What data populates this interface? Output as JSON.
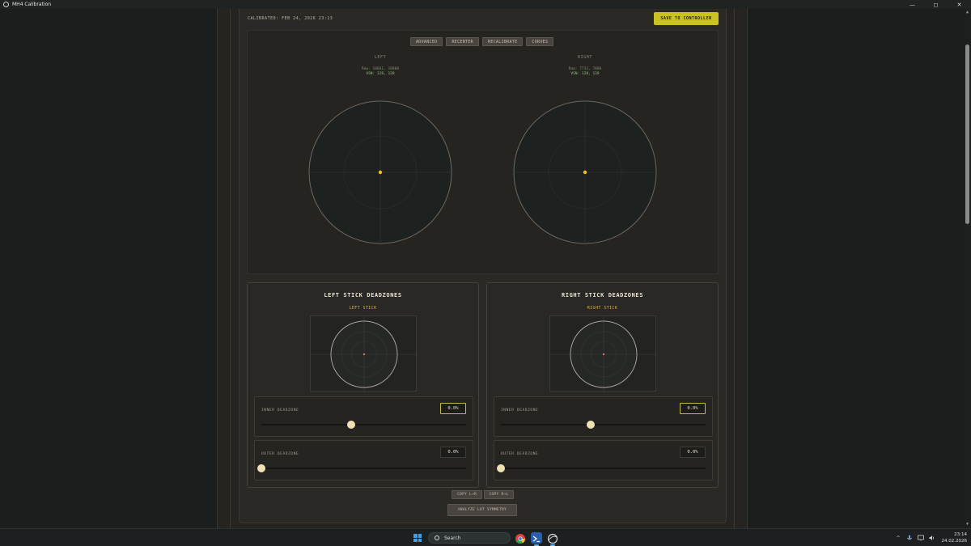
{
  "window": {
    "title": "MH4 Calibration",
    "controls": [
      "—",
      "◻",
      "✕"
    ]
  },
  "header": {
    "calibrated": "CALIBRATED: FEB 24, 2026 23:13",
    "save_label": "SAVE TO CONTROLLER"
  },
  "toolbar": {
    "advanced": "ADVANCED",
    "recenter": "RECENTER",
    "recalibrate": "RECALIBRATE",
    "curves": "CURVES"
  },
  "sticks": {
    "left": {
      "label": "LEFT",
      "raw": "Raw: 18661, 16808",
      "vsn": "VSN: 128, 128"
    },
    "right": {
      "label": "RIGHT",
      "raw": "Raw: 7711, 7806",
      "vsn": "VSN: 128, 128"
    }
  },
  "deadzones": {
    "left": {
      "title": "LEFT STICK DEADZONES",
      "subtitle": "LEFT STICK",
      "inner_label": "INNER DEADZONE",
      "inner_value": "0.0%",
      "inner_level": 0.44,
      "outer_label": "OUTER DEADZONE",
      "outer_value": "0.0%",
      "outer_level": 0.0
    },
    "right": {
      "title": "RIGHT STICK DEADZONES",
      "subtitle": "RIGHT STICK",
      "inner_label": "INNER DEADZONE",
      "inner_value": "0.0%",
      "inner_level": 0.44,
      "outer_label": "OUTER DEADZONE",
      "outer_value": "0.0%",
      "outer_level": 0.0
    }
  },
  "actions": {
    "copy_lr": "COPY L→R",
    "copy_rl": "COPY R→L",
    "analyze": "ANALYZE LUT SYMMETRY"
  },
  "taskbar": {
    "search": "Search",
    "time": "23:14",
    "date": "24.02.2026"
  },
  "colors": {
    "accent": "#c9c21f",
    "stick_dot": "#f0c020",
    "thumb": "#efe0b5"
  }
}
